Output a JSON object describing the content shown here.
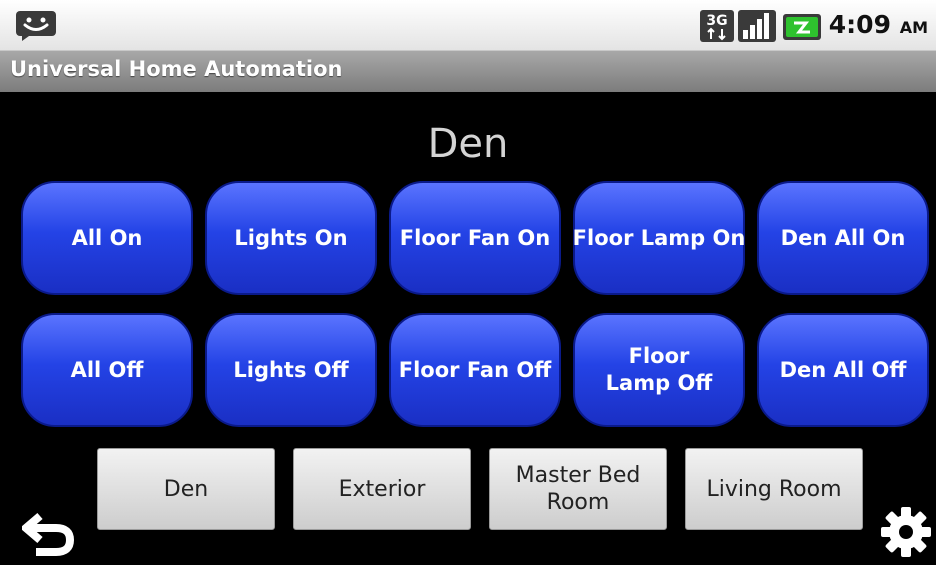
{
  "status_bar": {
    "network_badge": "3G",
    "time": "4:09",
    "ampm": "AM",
    "icons": [
      "notification-chat-icon",
      "network-3g-icon",
      "signal-icon",
      "battery-charging-icon"
    ]
  },
  "app": {
    "title": "Universal Home Automation"
  },
  "room_title": "Den",
  "controls": {
    "row1": [
      "All On",
      "Lights On",
      "Floor Fan On",
      "Floor Lamp On",
      "Den All On"
    ],
    "row2": [
      "All Off",
      "Lights Off",
      "Floor Fan Off",
      "Floor Lamp Off",
      "Den All Off"
    ]
  },
  "rooms": [
    "Den",
    "Exterior",
    "Master Bed Room",
    "Living Room"
  ],
  "bottom_icons": [
    "back-icon",
    "settings-icon"
  ],
  "colors": {
    "control_button": "#2443e6",
    "room_button": "#e0e0e0",
    "title_bar": "#8f8f8f",
    "battery_green": "#2ec22e"
  }
}
